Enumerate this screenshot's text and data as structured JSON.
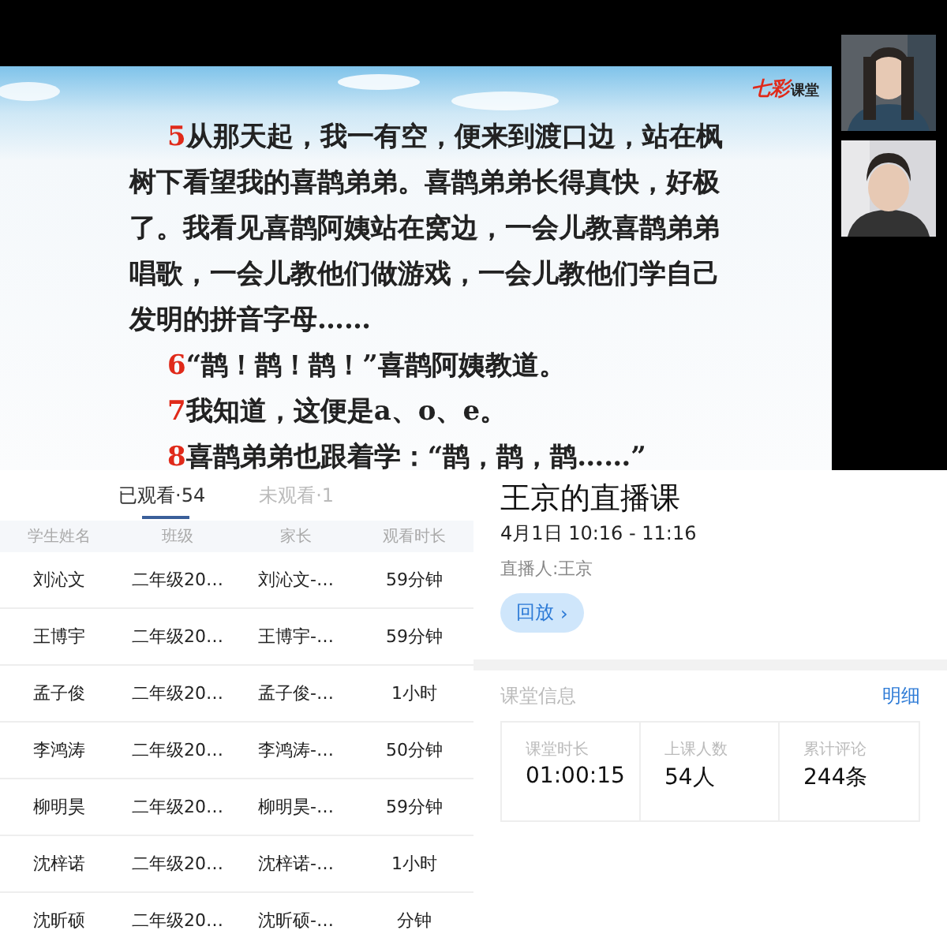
{
  "slide": {
    "logo": {
      "accent": "七彩",
      "text": "课堂"
    },
    "paragraphs": [
      {
        "number": "5",
        "text": "从那天起，我一有空，便来到渡口边，站在枫树下看望我的喜鹊弟弟。喜鹊弟弟长得真快，好极了。我看见喜鹊阿姨站在窝边，一会儿教喜鹊弟弟唱歌，一会儿教他们做游戏，一会儿教他们学自己发明的拼音字母……"
      },
      {
        "number": "6",
        "text": "“鹊！鹊！鹊！”喜鹊阿姨教道。"
      },
      {
        "number": "7",
        "text": "我知道，这便是a、o、e。"
      },
      {
        "number": "8",
        "text": "喜鹊弟弟也跟着学：“鹊，鹊，鹊……”"
      }
    ]
  },
  "viewers": {
    "tabs": [
      {
        "label": "已观看·54",
        "selected": true
      },
      {
        "label": "未观看·1",
        "selected": false
      }
    ],
    "columns": [
      "学生姓名",
      "班级",
      "家长",
      "观看时长"
    ],
    "rows": [
      [
        "刘沁文",
        "二年级20…",
        "刘沁文-…",
        "59分钟"
      ],
      [
        "王博宇",
        "二年级20…",
        "王博宇-…",
        "59分钟"
      ],
      [
        "孟子俊",
        "二年级20…",
        "孟子俊-…",
        "1小时"
      ],
      [
        "李鸿涛",
        "二年级20…",
        "李鸿涛-…",
        "50分钟"
      ],
      [
        "柳明昊",
        "二年级20…",
        "柳明昊-…",
        "59分钟"
      ],
      [
        "沈梓诺",
        "二年级20…",
        "沈梓诺-…",
        "1小时"
      ],
      [
        "沈昕硕",
        "二年级20…",
        "沈昕硕-…",
        "分钟"
      ]
    ]
  },
  "lesson": {
    "title": "王京的直播课",
    "time": "4月1日 10:16 - 11:16",
    "host": "直播人:王京",
    "replay_button": "回放",
    "replay_icon": "›",
    "info": {
      "heading": "课堂信息",
      "link": "明细",
      "stats": [
        {
          "label": "课堂时长",
          "value": "01:00:15"
        },
        {
          "label": "上课人数",
          "value": "54人"
        },
        {
          "label": "累计评论",
          "value": "244条"
        }
      ]
    }
  }
}
